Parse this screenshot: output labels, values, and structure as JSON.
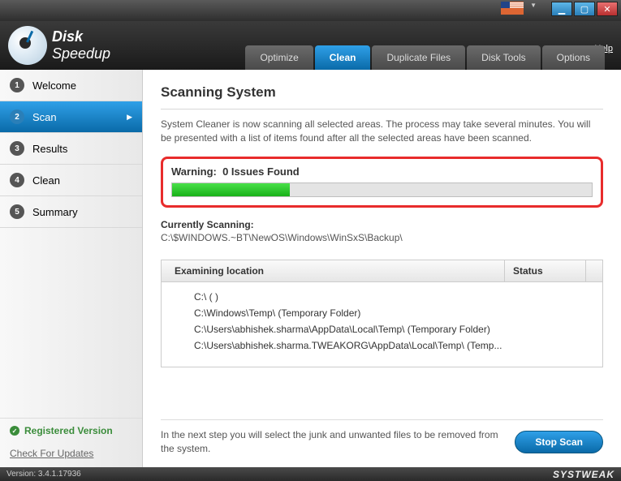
{
  "titlebar": {
    "help": "Help"
  },
  "logo": {
    "disk": "Disk",
    "speedup": "Speedup"
  },
  "tabs": {
    "optimize": "Optimize",
    "clean": "Clean",
    "duplicate": "Duplicate Files",
    "tools": "Disk Tools",
    "options": "Options"
  },
  "sidebar": {
    "steps": [
      {
        "num": "1",
        "label": "Welcome"
      },
      {
        "num": "2",
        "label": "Scan"
      },
      {
        "num": "3",
        "label": "Results"
      },
      {
        "num": "4",
        "label": "Clean"
      },
      {
        "num": "5",
        "label": "Summary"
      }
    ],
    "registered": "Registered Version",
    "updates": "Check For Updates"
  },
  "main": {
    "title": "Scanning System",
    "desc": "System Cleaner is now scanning all selected areas. The process may take several minutes. You will be presented with a list of items found after all the selected areas have been scanned.",
    "warning_label": "Warning:",
    "issues": "0 Issues Found",
    "progress_pct": "28%",
    "current_label": "Currently Scanning:",
    "current_path": "C:\\$WINDOWS.~BT\\NewOS\\Windows\\WinSxS\\Backup\\",
    "table": {
      "col_location": "Examining location",
      "col_status": "Status",
      "rows": [
        "C:\\  ( )",
        "C:\\Windows\\Temp\\  (Temporary Folder)",
        "C:\\Users\\abhishek.sharma\\AppData\\Local\\Temp\\  (Temporary Folder)",
        "C:\\Users\\abhishek.sharma.TWEAKORG\\AppData\\Local\\Temp\\  (Temp..."
      ]
    },
    "bottom_text": "In the next step you will select the junk and unwanted files to be removed from the system.",
    "stop": "Stop Scan"
  },
  "status": {
    "version": "Version: 3.4.1.17936",
    "brand": "SYSTWEAK"
  }
}
